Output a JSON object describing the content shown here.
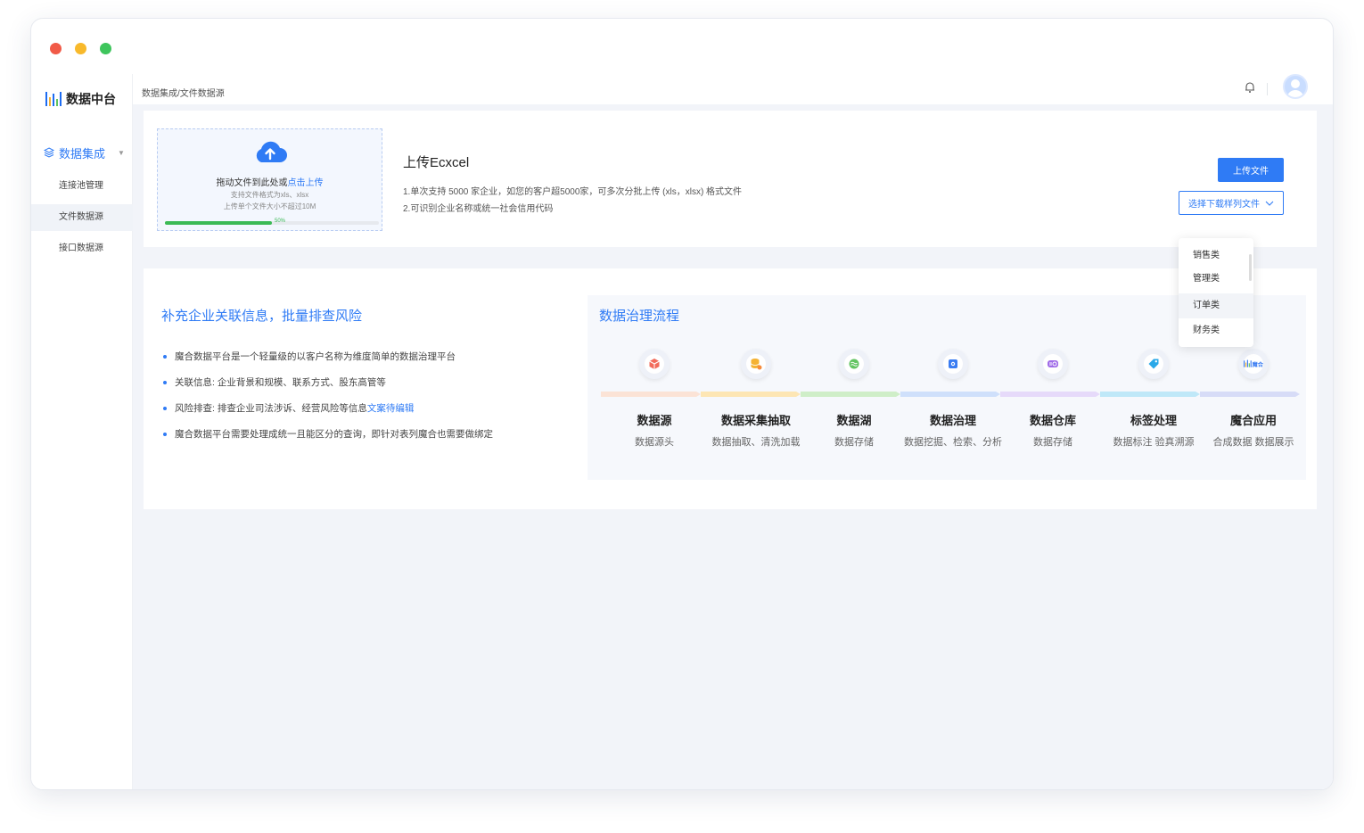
{
  "app": {
    "logo_text": "数据中台"
  },
  "sidebar": {
    "group_label": "数据集成",
    "items": [
      {
        "label": "连接池管理"
      },
      {
        "label": "文件数据源"
      },
      {
        "label": "接口数据源"
      }
    ]
  },
  "header": {
    "breadcrumb": "数据集成/文件数据源"
  },
  "upload": {
    "drop_text": "拖动文件到此处或",
    "drop_link": "点击上传",
    "format_hint": "支持文件格式为xls、xlsx",
    "size_hint": "上传单个文件大小不超过10M",
    "progress": 0.5,
    "progress_label": "50%",
    "title": "上传Ecxcel",
    "line1": "1.单次支持 5000 家企业，如您的客户超5000家，可多次分批上传 (xls，xlsx) 格式文件",
    "line2": "2.可识别企业名称或统一社会信用代码",
    "upload_button": "上传文件",
    "select_button": "选择下载样列文件"
  },
  "dropdown": {
    "options": [
      {
        "label": "销售类"
      },
      {
        "label": "管理类"
      },
      {
        "label": "订单类"
      },
      {
        "label": "财务类"
      }
    ],
    "highlighted": "订单类"
  },
  "info": {
    "title": "补充企业关联信息，批量排查风险",
    "bullets": [
      {
        "text": "魔合数据平台是一个轻量级的以客户名称为维度简单的数据治理平台",
        "link": ""
      },
      {
        "text": "关联信息: 企业背景和规模、联系方式、股东高管等",
        "link": ""
      },
      {
        "text": "风险排查: 排查企业司法涉诉、经营风险等信息",
        "link": "文案待编辑"
      },
      {
        "text": "魔合数据平台需要处理成统一且能区分的查询，即针对表列魔合也需要做绑定",
        "link": ""
      }
    ]
  },
  "flow": {
    "title": "数据治理流程",
    "stages": [
      {
        "title": "数据源",
        "sub": "数据源头",
        "icon": "cube-icon",
        "color": "#f26b5b",
        "band": "#fbe3d6"
      },
      {
        "title": "数据采集抽取",
        "sub": "数据抽取、清洗加载",
        "icon": "database-coin-icon",
        "color": "#f5b233",
        "band": "#fde6b4"
      },
      {
        "title": "数据湖",
        "sub": "数据存储",
        "icon": "lake-icon",
        "color": "#62c461",
        "band": "#cfeec8"
      },
      {
        "title": "数据治理",
        "sub": "数据挖掘、检索、分析",
        "icon": "gear-icon",
        "color": "#3a7cf2",
        "band": "#cfe0fb"
      },
      {
        "title": "数据仓库",
        "sub": "数据存储",
        "icon": "warehouse-icon",
        "color": "#a06be8",
        "band": "#e6dafa"
      },
      {
        "title": "标签处理",
        "sub": "数据标注  验真溯源",
        "icon": "tag-icon",
        "color": "#2aa8e8",
        "band": "#bfe8f8"
      },
      {
        "title": "魔合应用",
        "sub": "合成数据  数据展示",
        "icon": "mohe-logo-icon",
        "color": "#3a7cf2",
        "band": "#d7dcf7",
        "icon_text": "魔合"
      }
    ]
  }
}
